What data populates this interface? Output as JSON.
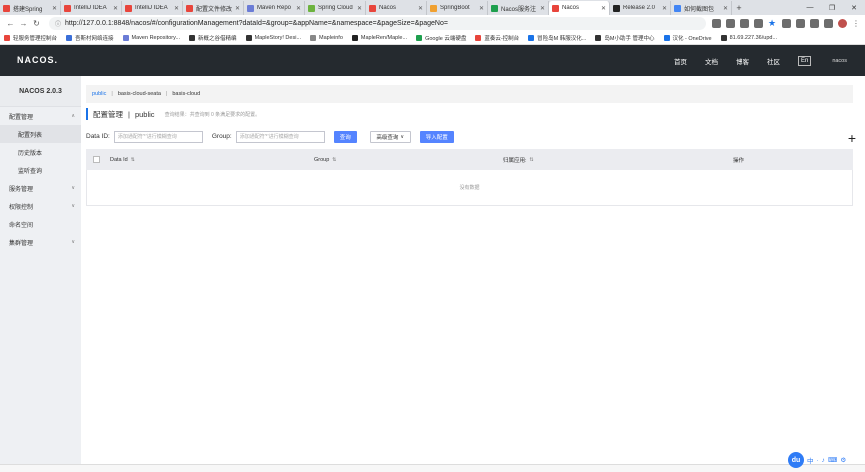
{
  "browser": {
    "tabs": [
      {
        "label": "搭建Spring",
        "color": "#e8453c",
        "active": false
      },
      {
        "label": "IntelliJ IDEA",
        "color": "#e8453c",
        "active": false
      },
      {
        "label": "IntelliJ IDEA",
        "color": "#e8453c",
        "active": false
      },
      {
        "label": "配置文件修改",
        "color": "#e8453c",
        "active": false
      },
      {
        "label": "Maven Repo",
        "color": "#6b7cd6",
        "active": false
      },
      {
        "label": "Spring Cloud",
        "color": "#6db33f",
        "active": false
      },
      {
        "label": "Nacos",
        "color": "#e8453c",
        "active": false
      },
      {
        "label": "SpringBoot",
        "color": "#f0a030",
        "active": false
      },
      {
        "label": "Nacos服务注",
        "color": "#1e9f4e",
        "active": false
      },
      {
        "label": "Nacos",
        "color": "#e8453c",
        "active": true
      },
      {
        "label": "Release 2.0",
        "color": "#222222",
        "active": false
      },
      {
        "label": "如何截图包",
        "color": "#4285f4",
        "active": false
      }
    ],
    "url": "http://127.0.0.1:8848/nacos/#/configurationManagement?dataId=&group=&appName=&namespace=&pageSize=&pageNo=",
    "bookmarks": [
      {
        "label": "轻服务管理控制台",
        "color": "#e8453c"
      },
      {
        "label": "吾斯村网络连接",
        "color": "#3a6fd8"
      },
      {
        "label": "Maven Repository...",
        "color": "#6b7cd6"
      },
      {
        "label": "新概之谷借精编",
        "color": "#333333"
      },
      {
        "label": "MapleStory! Desi...",
        "color": "#333333"
      },
      {
        "label": "Mapleinfo",
        "color": "#888888"
      },
      {
        "label": "MapleRen/Maple...",
        "color": "#222222"
      },
      {
        "label": "Google 云端硬盘",
        "color": "#1e9f4e"
      },
      {
        "label": "蓝奏云-控制台",
        "color": "#e8453c"
      },
      {
        "label": "冒险岛M 韩服汉化...",
        "color": "#1a73e8"
      },
      {
        "label": "岛M小助手 管理中心",
        "color": "#333333"
      },
      {
        "label": "汉化 - OneDrive",
        "color": "#1a73e8"
      },
      {
        "label": "81.69.227.36/upd...",
        "color": "#333333"
      }
    ]
  },
  "header": {
    "logo": "NACOS.",
    "nav": [
      "首页",
      "文档",
      "博客",
      "社区"
    ],
    "lang": "En",
    "user": "nacos"
  },
  "sidebar": {
    "title": "NACOS 2.0.3",
    "items": [
      {
        "label": "配置管理",
        "sub": false,
        "caret": "∧",
        "selected": false
      },
      {
        "label": "配置列表",
        "sub": true,
        "caret": "",
        "selected": true
      },
      {
        "label": "历史版本",
        "sub": true,
        "caret": "",
        "selected": false
      },
      {
        "label": "监听查询",
        "sub": true,
        "caret": "",
        "selected": false
      },
      {
        "label": "服务管理",
        "sub": false,
        "caret": "∨",
        "selected": false
      },
      {
        "label": "权限控制",
        "sub": false,
        "caret": "∨",
        "selected": false
      },
      {
        "label": "命名空间",
        "sub": false,
        "caret": "",
        "selected": false
      },
      {
        "label": "集群管理",
        "sub": false,
        "caret": "∨",
        "selected": false
      }
    ]
  },
  "namespaces": {
    "active": "public",
    "others": [
      "basis-cloud-seata",
      "basis-cloud"
    ]
  },
  "page": {
    "title": "配置管理",
    "namespace": "public",
    "desc": "查询结果：共查询到 0 条满足要求的配置。"
  },
  "filter": {
    "dataid_label": "Data ID:",
    "dataid_placeholder": "添加通配符'*'进行模糊查询",
    "group_label": "Group:",
    "group_placeholder": "添加通配符'*'进行模糊查询",
    "query_btn": "查询",
    "advanced_btn": "高级查询",
    "import_btn": "导入配置",
    "plus": "+"
  },
  "table": {
    "columns": [
      "Data Id",
      "Group",
      "归属应用:",
      "操作"
    ],
    "empty_text": "没有数据"
  },
  "ime": {
    "logo": "du",
    "icons": [
      "中",
      "·",
      "♪",
      "⌨",
      "⚙"
    ]
  }
}
